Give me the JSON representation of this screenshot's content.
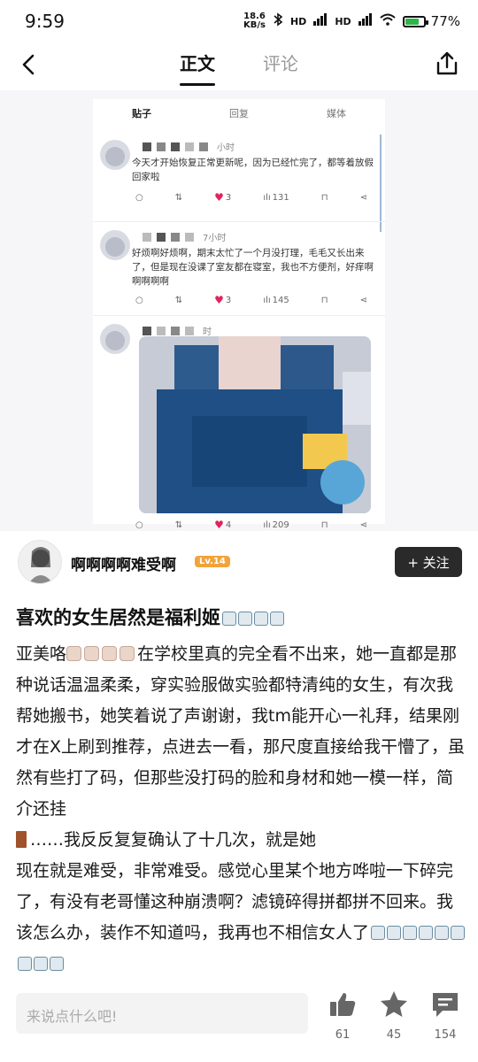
{
  "status_bar": {
    "time": "9:59",
    "net_speed_value": "18.6",
    "net_speed_unit": "KB/s",
    "signal_1": "HD",
    "signal_2": "HD",
    "battery_percent": "77%"
  },
  "header": {
    "tabs": [
      "正文",
      "评论"
    ],
    "active_tab": "正文"
  },
  "screenshot": {
    "tabs": [
      "贴子",
      "回复",
      "媒体"
    ],
    "posts": [
      {
        "time": "小时",
        "text": "今天才开始恢复正常更新呢，因为已经忙完了，都等着放假回家啦",
        "likes": "3",
        "views": "131"
      },
      {
        "time": "7小时",
        "text": "好烦啊好烦啊，期末太忙了一个月没打理，毛毛又长出来了，但是现在没课了室友都在寝室，我也不方便剂，好痒啊啊啊啊啊",
        "likes": "3",
        "views": "145"
      },
      {
        "time": "时",
        "likes": "4",
        "views": "209"
      }
    ]
  },
  "author": {
    "name": "啊啊啊啊难受啊",
    "level": "Lv.14",
    "follow_label": "+ 关注"
  },
  "post": {
    "title": "喜欢的女生居然是福利姬",
    "body_lines": [
      "亚美咯",
      "在学校里真的完全看不出来，她一直都是那种说话温温柔柔，穿实验服做实验都特清纯的女生，有次我帮她搬书，她笑着说了声谢谢，我tm能开心一礼拜，结果刚才在X上刷到推荐，点进去一看，那尺度直接给我干懵了，虽然有些打了码，但那些没打码的脸和身材和她一模一样，简介还挂",
      "……我反反复复确认了十几次，就是她",
      "现在就是难受，非常难受。感觉心里某个地方哗啦一下碎完了，有没有老哥懂这种崩溃啊？滤镜碎得拼都拼不回来。我该怎么办，装作不知道吗，我再也不相信女人了"
    ]
  },
  "bottom_bar": {
    "comment_placeholder": "来说点什么吧!",
    "like_count": "61",
    "favorite_count": "45",
    "comment_count": "154"
  },
  "colors": {
    "accent": "#2a2a2a",
    "level_badge": "#f2a33a",
    "heart": "#e0245e",
    "battery": "#2fb34b"
  },
  "icons": [
    "back-icon",
    "share-icon",
    "thumbs-up-icon",
    "star-icon",
    "comment-icon"
  ]
}
